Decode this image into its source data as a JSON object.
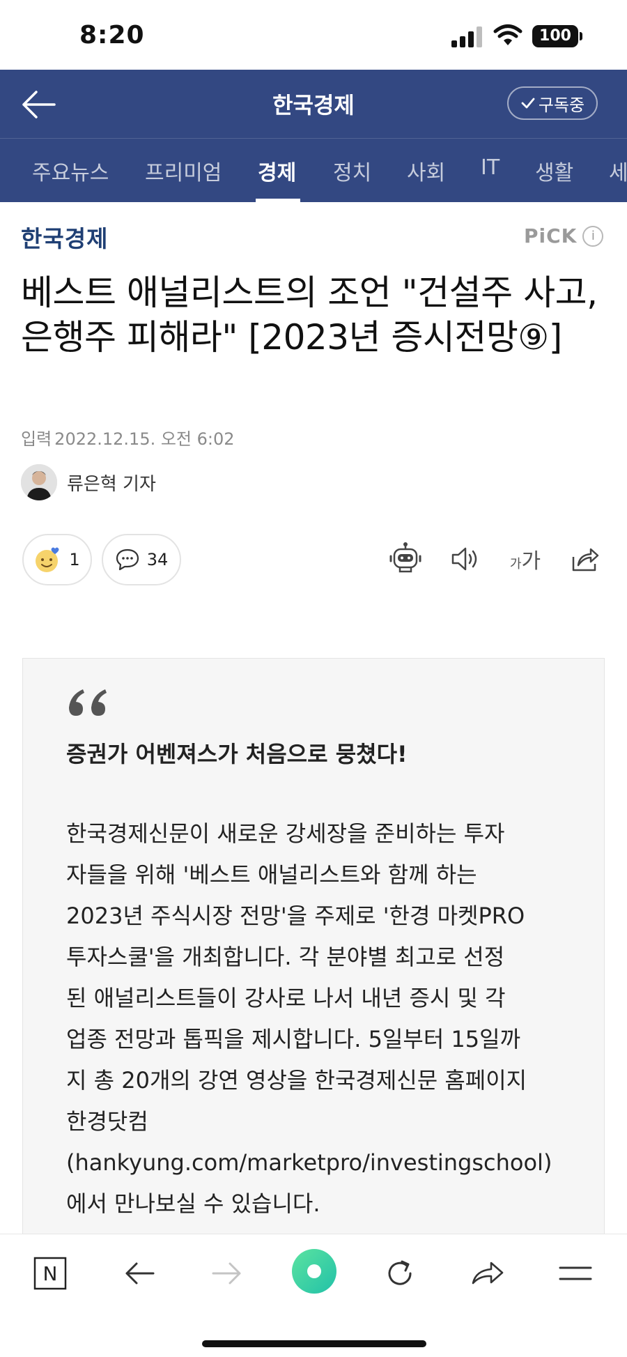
{
  "status_bar": {
    "time": "8:20",
    "battery": "100"
  },
  "header": {
    "press_name": "한국경제",
    "subscribe_label": "구독중"
  },
  "tabs": [
    {
      "label": "주요뉴스"
    },
    {
      "label": "프리미엄"
    },
    {
      "label": "경제"
    },
    {
      "label": "정치"
    },
    {
      "label": "사회"
    },
    {
      "label": "IT"
    },
    {
      "label": "생활"
    },
    {
      "label": "세"
    }
  ],
  "active_tab": "경제",
  "article": {
    "press_logo": "한국경제",
    "pick": "PiCK",
    "pick_info": "i",
    "title": "베스트 애널리스트의 조언 \"건설주 사고, 은행주 피해라\" [2023년 증시전망⑨]",
    "date_label": "입력",
    "date": "2022.12.15. 오전 6:02",
    "reporter": "류은혁 기자",
    "reaction_count": "1",
    "comment_count": "34",
    "font_size_small": "가",
    "font_size_large": "가"
  },
  "summary": {
    "heading": "증권가 어벤져스가 처음으로 뭉쳤다!",
    "lines": [
      "한국경제신문이 새로운 강세장을 준비하는 투자",
      "자들을 위해 '베스트 애널리스트와 함께 하는",
      "2023년 주식시장 전망'을 주제로 '한경 마켓PRO",
      "투자스쿨'을 개최합니다. 각 분야별 최고로 선정",
      "된 애널리스트들이 강사로 나서 내년 증시 및 각",
      "업종 전망과 톱픽을 제시합니다. 5일부터 15일까",
      "지 총 20개의 강연 영상을 한국경제신문 홈페이지",
      "한경닷컴",
      "(hankyung.com/marketpro/investingschool)",
      "에서 만나보실 수 있습니다."
    ]
  },
  "colors": {
    "header_bg": "#334882",
    "press_logo": "#1f3f74",
    "accent_green": "#3ccf8e"
  },
  "toolbar": {
    "icons": [
      "naver-n-icon",
      "back-arrow-icon",
      "forward-arrow-icon",
      "green-dot-icon",
      "refresh-icon",
      "share-icon",
      "menu-icon"
    ],
    "naver_label": "N"
  }
}
